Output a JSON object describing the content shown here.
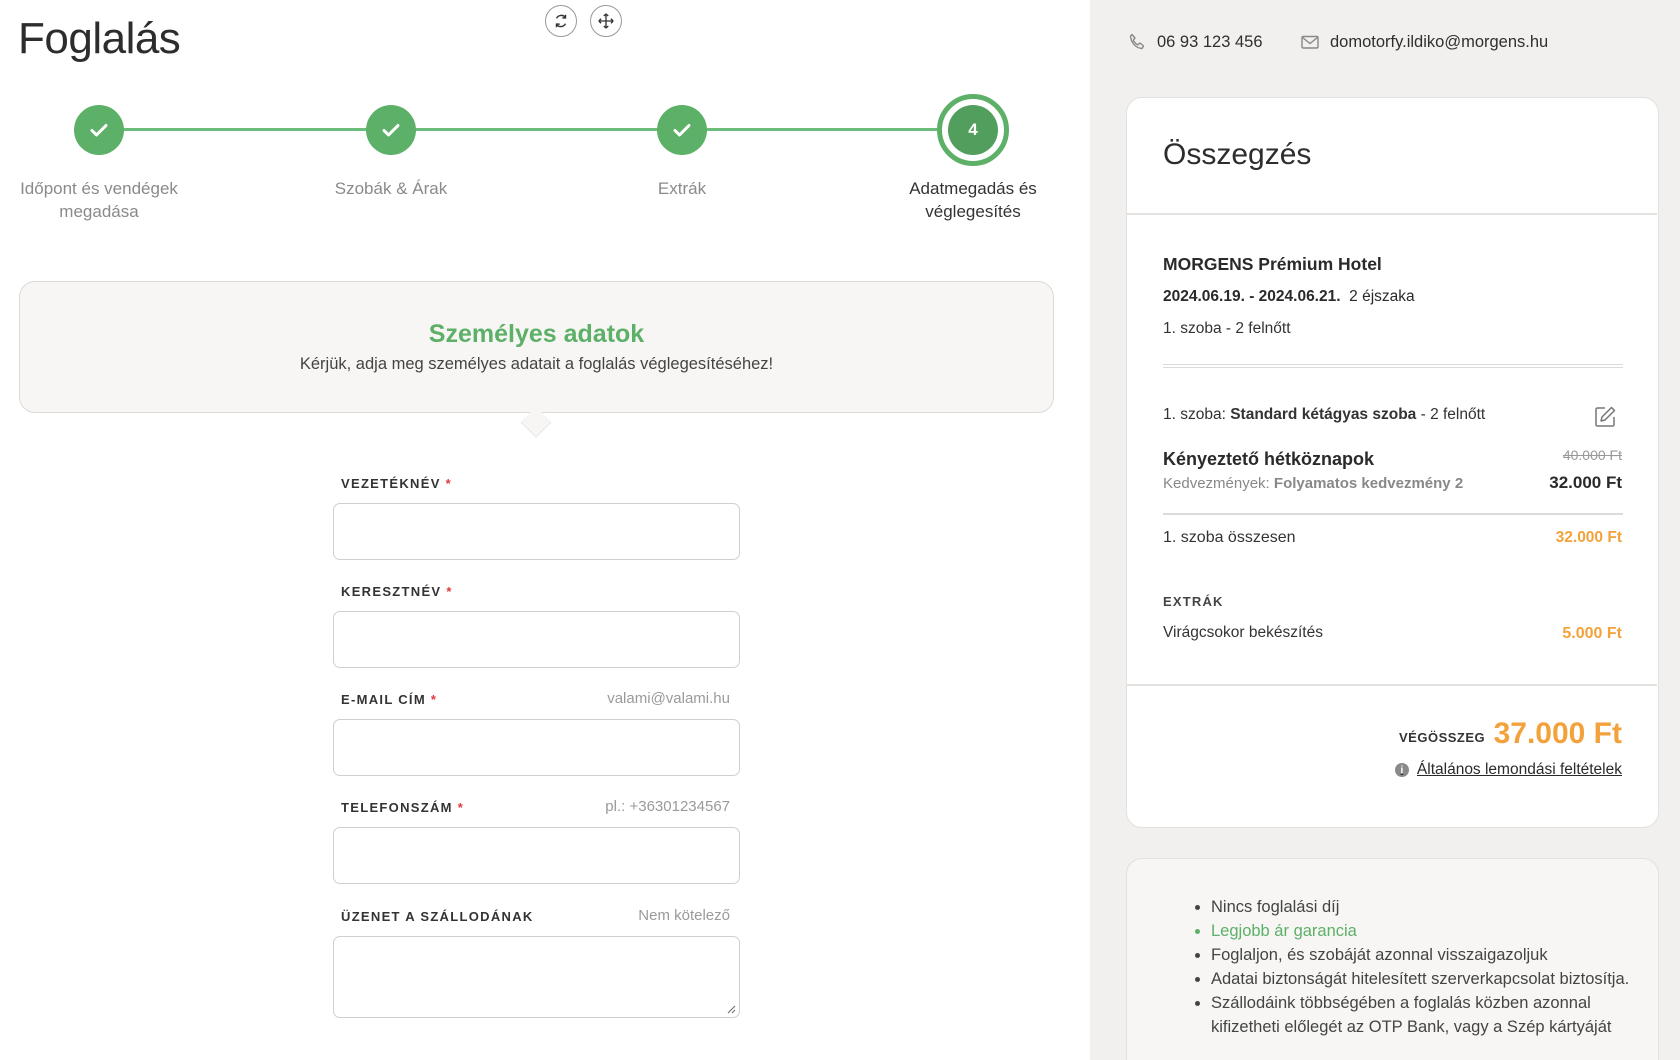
{
  "page": {
    "title": "Foglalás"
  },
  "steps": [
    {
      "label_1": "Időpont és vendégek",
      "label_2": "megadása",
      "state": "done"
    },
    {
      "label_1": "Szobák & Árak",
      "label_2": "",
      "state": "done"
    },
    {
      "label_1": "Extrák",
      "label_2": "",
      "state": "done"
    },
    {
      "label_1": "Adatmegadás és",
      "label_2": "véglegesítés",
      "state": "active",
      "number": "4"
    }
  ],
  "personal": {
    "title": "Személyes adatok",
    "subtitle": "Kérjük, adja meg személyes adatait a foglalás véglegesítéséhez!"
  },
  "form": {
    "last_name": {
      "label": "VEZETÉKNÉV",
      "required": "*",
      "hint": ""
    },
    "first_name": {
      "label": "KERESZTNÉV",
      "required": "*",
      "hint": ""
    },
    "email": {
      "label": "E-MAIL CÍM",
      "required": "*",
      "hint": "valami@valami.hu"
    },
    "phone": {
      "label": "TELEFONSZÁM",
      "required": "*",
      "hint": "pl.: +36301234567"
    },
    "message": {
      "label": "ÜZENET A SZÁLLODÁNAK",
      "hint": "Nem kötelező"
    }
  },
  "contact": {
    "phone": "06 93 123 456",
    "email": "domotorfy.ildiko@morgens.hu"
  },
  "summary": {
    "title": "Összegzés",
    "hotel": "MORGENS Prémium Hotel",
    "dates": "2024.06.19. - 2024.06.21.",
    "nights": "2 éjszaka",
    "rooms": "1. szoba - 2 felnőtt",
    "room_line_prefix": "1. szoba:",
    "room_type": "Standard kétágyas szoba",
    "room_line_suffix": "- 2 felnőtt",
    "package": "Kényeztető hétköznapok",
    "discount_prefix": "Kedvezmények:",
    "discount_name": "Folyamatos kedvezmény 2",
    "old_price": "40.000 Ft",
    "new_price": "32.000 Ft",
    "room_total_label": "1. szoba összesen",
    "room_total": "32.000 Ft",
    "extras_title": "EXTRÁK",
    "extra_item": "Virágcsokor bekészítés",
    "extra_price": "5.000 Ft",
    "total_label": "VÉGÖSSZEG",
    "total_value": "37.000 Ft",
    "cancel_link": "Általános lemondási feltételek"
  },
  "benefits": [
    "Nincs foglalási díj",
    "Legjobb ár garancia",
    "Foglaljon, és szobáját azonnal visszaigazoljuk",
    "Adatai biztonságát hitelesített szerverkapcsolat biztosítja.",
    "Szállodáink többségében a foglalás közben azonnal kifizetheti előlegét az OTP Bank, vagy a Szép kártyáját"
  ],
  "colors": {
    "green": "#5db068",
    "orange": "#f3a23b",
    "panel": "#f1f0ee"
  }
}
